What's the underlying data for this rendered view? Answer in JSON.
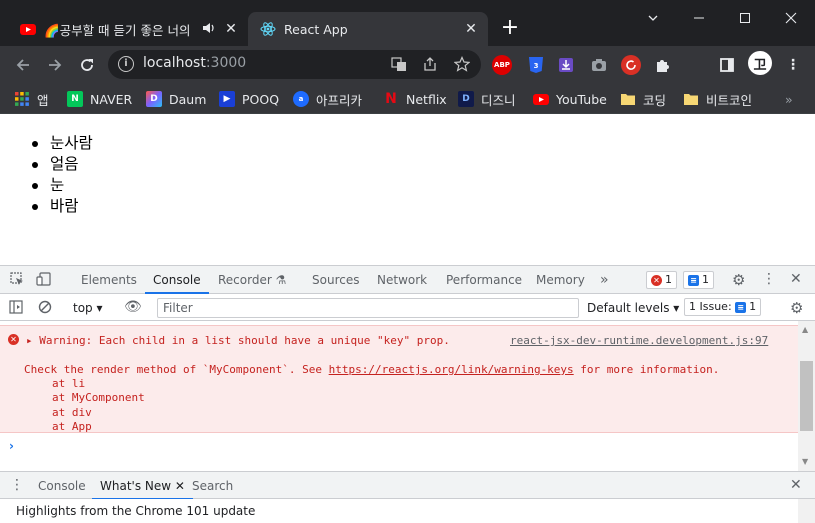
{
  "tabs": {
    "inactive_title": "🌈공부할 때 듣기 좋은 너의",
    "active_title": "React App"
  },
  "toolbar": {
    "url_host": "localhost",
    "url_port": ":3000",
    "profile_initial": "卫"
  },
  "extensions": [
    "ABP",
    "CSS",
    "download-ext",
    "camera-ext",
    "refresh-ext",
    "puzzle-ext"
  ],
  "bookmarks": {
    "apps": "앱",
    "items": [
      "NAVER",
      "Daum",
      "POOQ",
      "아프리카",
      "Netflix",
      "디즈니",
      "YouTube",
      "코딩",
      "비트코인"
    ],
    "more": "»"
  },
  "page": {
    "list": [
      "눈사람",
      "얼음",
      "눈",
      "바람"
    ]
  },
  "devtools": {
    "tabs": [
      "Elements",
      "Console",
      "Recorder",
      "Sources",
      "Network",
      "Performance",
      "Memory"
    ],
    "more_tabs": "»",
    "error_count": "1",
    "message_count": "1",
    "context": "top",
    "filter_placeholder": "Filter",
    "default_levels": "Default levels ▾",
    "issues": "1 Issue:",
    "issues_count": "1",
    "warning_line": "Warning: Each child in a list should have a unique \"key\" prop.",
    "source_file": "react-jsx-dev-runtime.development.js:97",
    "check_prefix": "Check the render method of `MyComponent`. See ",
    "check_link": "https://reactjs.org/link/warning-keys",
    "check_suffix": " for more information.",
    "stack": [
      "at li",
      "at MyComponent",
      "at div",
      "at App"
    ],
    "drawer_tabs": [
      "Console",
      "What's New",
      "Search"
    ],
    "drawer_text": "Highlights from the Chrome 101 update"
  },
  "colors": {
    "chrome_dark": "#202124",
    "toolbar": "#35363a",
    "error_bg": "#fcebeb",
    "error_text": "#c5221f",
    "accent": "#1a73e8"
  }
}
